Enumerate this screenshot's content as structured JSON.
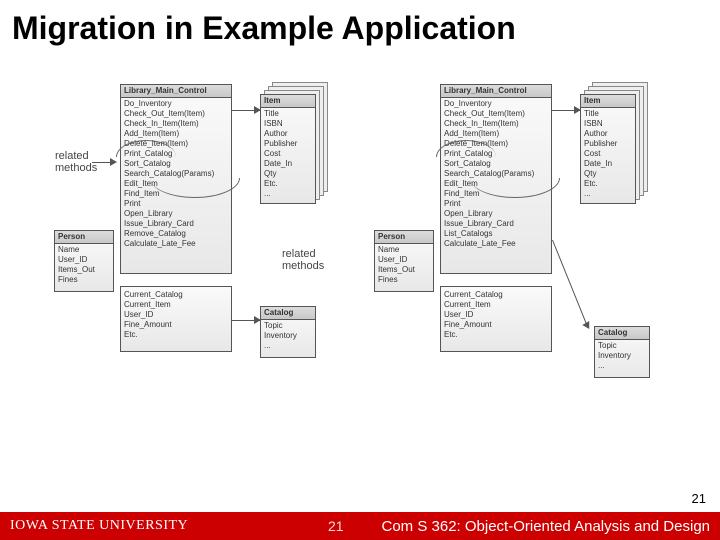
{
  "title": "Migration in Example Application",
  "labels": {
    "related_methods_left": "related\nmethods",
    "related_methods_right": "related\nmethods"
  },
  "left": {
    "main": {
      "header": "Library_Main_Control",
      "lines": [
        "Do_Inventory",
        "Check_Out_Item(Item)",
        "Check_In_Item(Item)",
        "Add_Item(Item)",
        "Delete_Item(Item)",
        "Print_Catalog",
        "Sort_Catalog",
        "Search_Catalog(Params)",
        "Edit_Item",
        "Find_Item",
        "Print",
        "Open_Library",
        "Issue_Library_Card",
        "Remove_Catalog",
        "Calculate_Late_Fee"
      ]
    },
    "item": {
      "header": "Item",
      "lines": [
        "Title",
        "ISBN",
        "Author",
        "Publisher",
        "Cost",
        "Date_In",
        "Qty",
        "Etc.",
        "..."
      ]
    },
    "person": {
      "header": "Person",
      "lines": [
        "Name",
        "User_ID",
        "Items_Out",
        "Fines"
      ]
    },
    "state": {
      "header": "",
      "lines": [
        "Current_Catalog",
        "Current_Item",
        "User_ID",
        "Fine_Amount",
        "Etc."
      ]
    },
    "catalog": {
      "header": "Catalog",
      "lines": [
        "Topic",
        "Inventory",
        "..."
      ]
    }
  },
  "right": {
    "main": {
      "header": "Library_Main_Control",
      "lines": [
        "Do_Inventory",
        "Check_Out_Item(Item)",
        "Check_In_Item(Item)",
        "Add_Item(Item)",
        "Delete_Item(Item)",
        "Print_Catalog",
        "Sort_Catalog",
        "Search_Catalog(Params)",
        "Edit_Item",
        "Find_Item",
        "Print",
        "Open_Library",
        "Issue_Library_Card",
        "List_Catalogs",
        "Calculate_Late_Fee"
      ]
    },
    "item": {
      "header": "Item",
      "lines": [
        "Title",
        "ISBN",
        "Author",
        "Publisher",
        "Cost",
        "Date_In",
        "Qty",
        "Etc.",
        "..."
      ]
    },
    "person": {
      "header": "Person",
      "lines": [
        "Name",
        "User_ID",
        "Items_Out",
        "Fines"
      ]
    },
    "state": {
      "header": "",
      "lines": [
        "Current_Catalog",
        "Current_Item",
        "User_ID",
        "Fine_Amount",
        "Etc."
      ]
    },
    "catalog": {
      "header": "Catalog",
      "lines": [
        "Topic",
        "Inventory",
        "..."
      ]
    }
  },
  "footer": {
    "university": "IOWA STATE UNIVERSITY",
    "course": "Com S 362: Object-Oriented Analysis and Design",
    "page": "21",
    "subpage": "21"
  }
}
